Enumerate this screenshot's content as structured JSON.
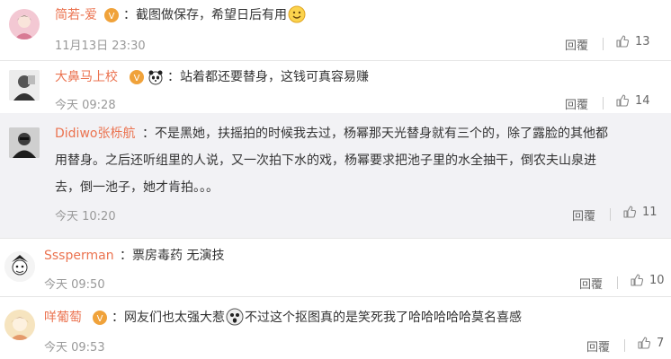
{
  "comments": [
    {
      "username": "简若-爱",
      "text": "截图做保存，希望日后有用",
      "time": "11月13日 23:30",
      "reply_label": "回覆",
      "likes": "13"
    },
    {
      "username": "大鼻马上校",
      "text": "站着都还要替身，这钱可真容易赚",
      "time": "今天 09:28",
      "reply_label": "回覆",
      "likes": "14"
    },
    {
      "username": "Didiwo张栎航",
      "text_line1": "不是黑她，扶摇拍的时候我去过，杨幂那天光替身就有三个的，除了露脸的其他都",
      "text_line2": "用替身。之后还听组里的人说，又一次拍下水的戏，杨幂要求把池子里的水全抽干，倒农夫山泉进",
      "text_line3": "去，倒一池子，她才肯拍。。。",
      "time": "今天 10:20",
      "reply_label": "回覆",
      "likes": "11"
    },
    {
      "username": "Sssperman",
      "text": "票房毒药 无演技",
      "time": "今天 09:50",
      "reply_label": "回覆",
      "likes": "10"
    },
    {
      "username": "咩葡萄",
      "text_a": "网友们也太强大惹",
      "text_b": "不过这个抠图真的是笑死我了哈哈哈哈哈莫名喜感",
      "time": "今天 09:53",
      "reply_label": "回覆",
      "likes": "7"
    }
  ],
  "colors": {
    "username": "#eb7350",
    "text": "#333333",
    "meta": "#999999"
  }
}
